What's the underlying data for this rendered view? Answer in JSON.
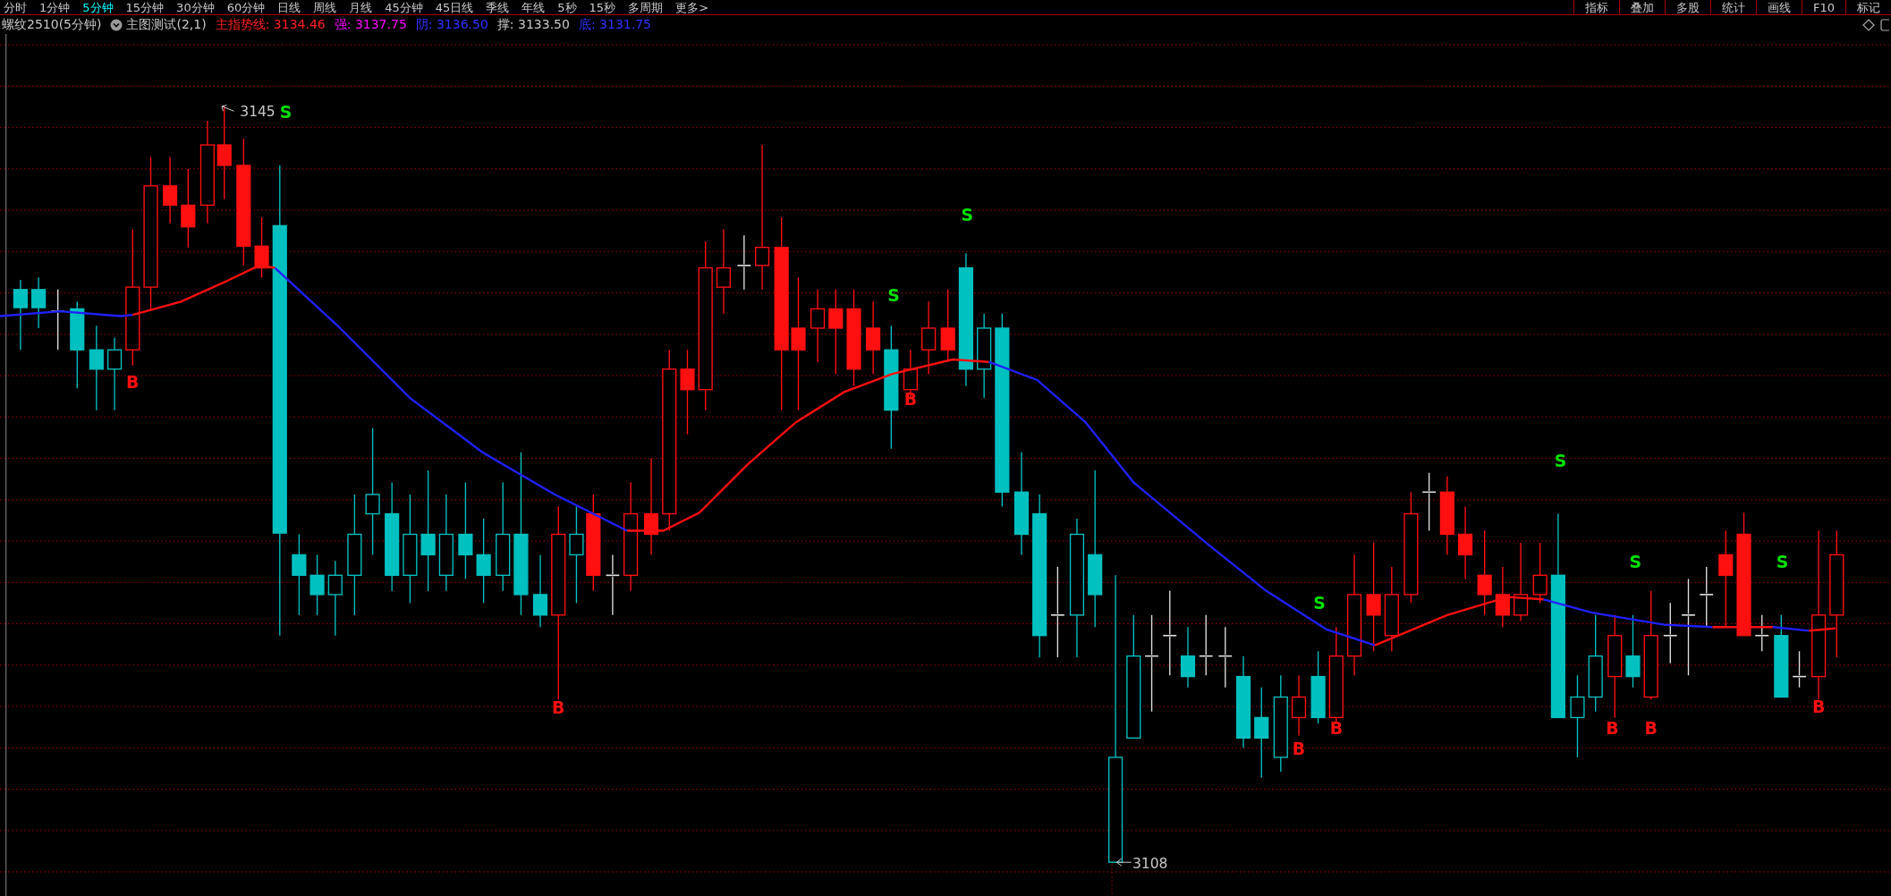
{
  "period_tabs": [
    {
      "label": "分时",
      "selected": false
    },
    {
      "label": "1分钟",
      "selected": false
    },
    {
      "label": "5分钟",
      "selected": true
    },
    {
      "label": "15分钟",
      "selected": false
    },
    {
      "label": "30分钟",
      "selected": false
    },
    {
      "label": "60分钟",
      "selected": false
    },
    {
      "label": "日线",
      "selected": false
    },
    {
      "label": "周线",
      "selected": false
    },
    {
      "label": "月线",
      "selected": false
    },
    {
      "label": "45分钟",
      "selected": false
    },
    {
      "label": "45日线",
      "selected": false
    },
    {
      "label": "季线",
      "selected": false
    },
    {
      "label": "年线",
      "selected": false
    },
    {
      "label": "5秒",
      "selected": false
    },
    {
      "label": "15秒",
      "selected": false
    },
    {
      "label": "多周期",
      "selected": false
    },
    {
      "label": "更多>",
      "selected": false
    }
  ],
  "toolbar_buttons": [
    "指标",
    "叠加",
    "多股",
    "统计",
    "画线",
    "F10",
    "标记"
  ],
  "chart_header": {
    "symbol": "螺纹2510(5分钟)",
    "indicator_name": "主图测试(2,1)",
    "readings": [
      {
        "text": "主指势线: 3134.46",
        "color": "#ff2020"
      },
      {
        "text": "强: 3137.75",
        "color": "#ff00ff"
      },
      {
        "text": "阴: 3136.50",
        "color": "#3030ff"
      },
      {
        "text": "撑: 3133.50",
        "color": "#c8c8c8"
      },
      {
        "text": "底: 3131.75",
        "color": "#3030ff"
      }
    ]
  },
  "price_marks": [
    {
      "kind": "high",
      "text": "3145"
    },
    {
      "kind": "low",
      "text": "3108"
    }
  ],
  "signals": [
    {
      "kind": "buy",
      "label": "B"
    },
    {
      "kind": "sell",
      "label": "S"
    },
    {
      "kind": "buy",
      "label": "B"
    },
    {
      "kind": "sell",
      "label": "S"
    },
    {
      "kind": "buy",
      "label": "B"
    },
    {
      "kind": "sell",
      "label": "S"
    },
    {
      "kind": "buy",
      "label": "B"
    },
    {
      "kind": "sell",
      "label": "S"
    },
    {
      "kind": "buy",
      "label": "B"
    },
    {
      "kind": "sell",
      "label": "S"
    },
    {
      "kind": "buy",
      "label": "B"
    },
    {
      "kind": "sell",
      "label": "S"
    },
    {
      "kind": "buy",
      "label": "B"
    },
    {
      "kind": "sell",
      "label": "S"
    },
    {
      "kind": "buy",
      "label": "B"
    }
  ]
}
